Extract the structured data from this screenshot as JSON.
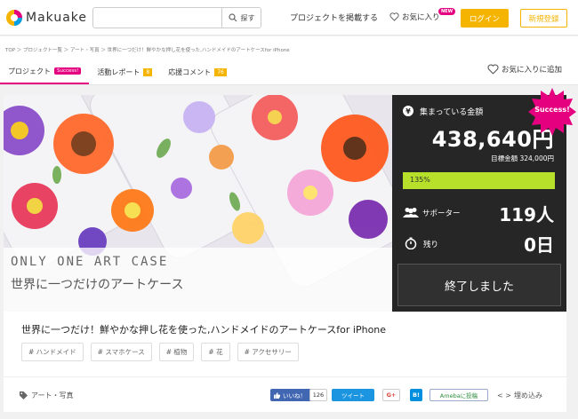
{
  "header": {
    "logo_text": "Makuake",
    "search_placeholder": "",
    "search_button": "探す",
    "post_project": "プロジェクトを掲載する",
    "favorites": "お気に入り",
    "new_badge": "NEW",
    "login": "ログイン",
    "register": "新規登録"
  },
  "breadcrumb": "TOP ＞ プロジェクト一覧 ＞ アート・写真 ＞ 世界に一つだけ！鮮やかな押し花を使った,ハンドメイドのアートケースfor iPhone",
  "tabs": [
    {
      "label": "プロジェクト",
      "badge": "Success!"
    },
    {
      "label": "活動レポート",
      "badge": "8"
    },
    {
      "label": "応援コメント",
      "badge": "76"
    }
  ],
  "add_favorite": "お気に入りに追加",
  "hero": {
    "caption_en": "ONLY ONE ART CASE",
    "caption_jp": "世界に一つだけのアートケース"
  },
  "panel": {
    "amount_label": "集まっている金額",
    "amount": "438,640円",
    "goal": "目標金額 324,000円",
    "progress_label": "135%",
    "progress_fraction": 1.0,
    "supporters_label": "サポーター",
    "supporters_count": "119人",
    "remaining_label": "残り",
    "remaining_count": "0日",
    "ended": "終了しました",
    "success_badge": "Success!"
  },
  "project": {
    "title": "世界に一つだけ！鮮やかな押し花を使った,ハンドメイドのアートケースfor iPhone",
    "tags": [
      "# ハンドメイド",
      "# スマホケース",
      "# 植物",
      "# 花",
      "# アクセサリー"
    ]
  },
  "footer": {
    "category": "アート・写真",
    "fb_like": "いいね！",
    "fb_count": "126",
    "tweet": "ツイート",
    "gplus": "G+",
    "hatena": "B!",
    "ameba": "Amebaに投稿",
    "embed": "埋め込み"
  },
  "colors": {
    "brand_pink": "#e4007f",
    "accent_yellow": "#f5b400",
    "progress_green": "#b6e02a",
    "panel_dark": "#262626"
  }
}
